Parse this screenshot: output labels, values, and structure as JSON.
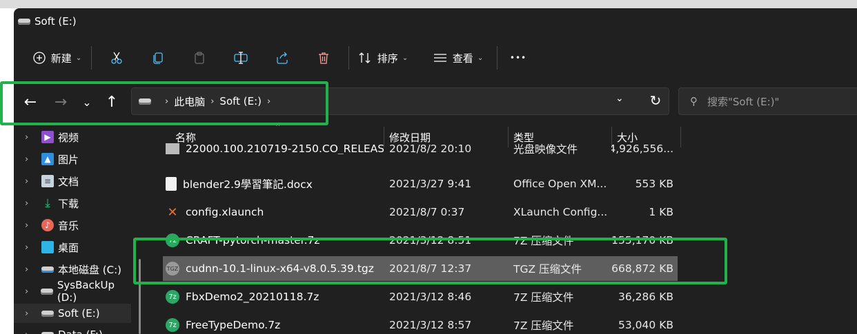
{
  "window": {
    "title": "Soft (E:)"
  },
  "toolbar": {
    "new_label": "新建",
    "sort_label": "排序",
    "view_label": "查看",
    "more_label": "•••"
  },
  "nav": {
    "breadcrumb": [
      "此电脑",
      "Soft (E:)"
    ],
    "search_placeholder": "搜索\"Soft (E:)\""
  },
  "columns": {
    "name": "名称",
    "date": "修改日期",
    "type": "类型",
    "size": "大小"
  },
  "files": [
    {
      "name": "22000.100.210719-2150.CO_RELEAS...",
      "date": "2021/8/2 20:10",
      "type": "光盘映像文件",
      "size": "4,926,556..."
    },
    {
      "name": "blender2.9學習筆記.docx",
      "date": "2021/3/27 9:41",
      "type": "Office Open XM...",
      "size": "553 KB"
    },
    {
      "name": "config.xlaunch",
      "date": "2021/8/7 0:37",
      "type": "XLaunch Config...",
      "size": "1 KB"
    },
    {
      "name": "CRAFT-pytorch-master.7z",
      "date": "2021/3/12 8:51",
      "type": "7Z 压缩文件",
      "size": "155,170 KB"
    },
    {
      "name": "cudnn-10.1-linux-x64-v8.0.5.39.tgz",
      "date": "2021/8/7 12:37",
      "type": "TGZ 压缩文件",
      "size": "668,872 KB"
    },
    {
      "name": "FbxDemo2_20210118.7z",
      "date": "2021/3/12 8:46",
      "type": "7Z 压缩文件",
      "size": "36,286 KB"
    },
    {
      "name": "FreeTypeDemo.7z",
      "date": "2021/3/12 8:57",
      "type": "7Z 压缩文件",
      "size": "53,040 KB"
    }
  ],
  "sidebar": [
    {
      "label": "视频",
      "icon": "video-icon"
    },
    {
      "label": "图片",
      "icon": "pictures-icon"
    },
    {
      "label": "文档",
      "icon": "documents-icon"
    },
    {
      "label": "下载",
      "icon": "downloads-icon"
    },
    {
      "label": "音乐",
      "icon": "music-icon"
    },
    {
      "label": "桌面",
      "icon": "desktop-icon"
    },
    {
      "label": "本地磁盘 (C:)",
      "icon": "drive-icon"
    },
    {
      "label": "SysBackUp (D:)",
      "icon": "drive-icon"
    },
    {
      "label": "Soft (E:)",
      "icon": "drive-icon"
    },
    {
      "label": "Data (F:)",
      "icon": "drive-icon"
    }
  ],
  "colors": {
    "highlight_box": "#21b24b",
    "window_bg": "#202020",
    "selected_row": "#5e5e5e"
  }
}
